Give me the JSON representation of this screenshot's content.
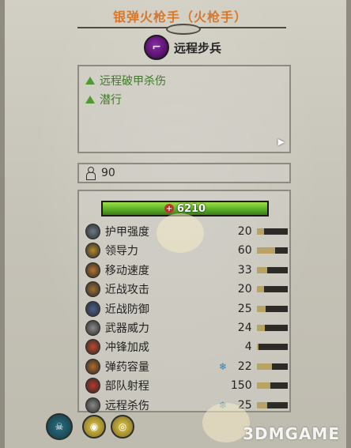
{
  "unit": {
    "title": "银弹火枪手（火枪手）",
    "class_label": "远程步兵",
    "class_icon": "musket-icon",
    "abilities": [
      {
        "label": "远程破甲杀伤",
        "icon": "green-triangle-icon"
      },
      {
        "label": "潜行",
        "icon": "green-triangle-icon"
      }
    ],
    "unit_size": "90",
    "health": {
      "value": "6210",
      "fraction": 1.0
    }
  },
  "stats": [
    {
      "label": "护甲强度",
      "value": "20",
      "boost": "",
      "fraction": 0.25,
      "icon": "armor-icon",
      "color": "#6c7a85"
    },
    {
      "label": "领导力",
      "value": "60",
      "boost": "",
      "fraction": 0.6,
      "icon": "leadership-icon",
      "color": "#b48a2c"
    },
    {
      "label": "移动速度",
      "value": "33",
      "boost": "",
      "fraction": 0.35,
      "icon": "speed-icon",
      "color": "#b4742c"
    },
    {
      "label": "近战攻击",
      "value": "20",
      "boost": "",
      "fraction": 0.25,
      "icon": "melee-attack-icon",
      "color": "#a07030"
    },
    {
      "label": "近战防御",
      "value": "25",
      "boost": "",
      "fraction": 0.28,
      "icon": "melee-defense-icon",
      "color": "#4a5f8a"
    },
    {
      "label": "武器威力",
      "value": "24",
      "boost": "",
      "fraction": 0.27,
      "icon": "weapon-strength-icon",
      "color": "#8a8a8a"
    },
    {
      "label": "冲锋加成",
      "value": "4",
      "boost": "",
      "fraction": 0.05,
      "icon": "charge-bonus-icon",
      "color": "#c0472a"
    },
    {
      "label": "弹药容量",
      "value": "22",
      "boost": "❄",
      "fraction": 0.5,
      "icon": "ammunition-icon",
      "color": "#b06a2a"
    },
    {
      "label": "部队射程",
      "value": "150",
      "boost": "",
      "fraction": 0.45,
      "icon": "range-icon",
      "color": "#b83a2a"
    },
    {
      "label": "远程杀伤",
      "value": "25",
      "boost": "❄",
      "fraction": 0.35,
      "icon": "missile-damage-icon",
      "color": "#8a8a8a"
    }
  ],
  "watermark": "3DMGAME",
  "colors": {
    "title": "#d8782a",
    "ability_text": "#3e7a28",
    "health_fill": "#5fb42a",
    "stat_bar_fill": "#b8a362"
  },
  "buttons": [
    {
      "name": "unit-card-button",
      "icon": "skull-icon"
    },
    {
      "name": "eye-button",
      "icon": "eye-icon"
    },
    {
      "name": "eye-toggle-button",
      "icon": "eye-slash-icon"
    }
  ]
}
